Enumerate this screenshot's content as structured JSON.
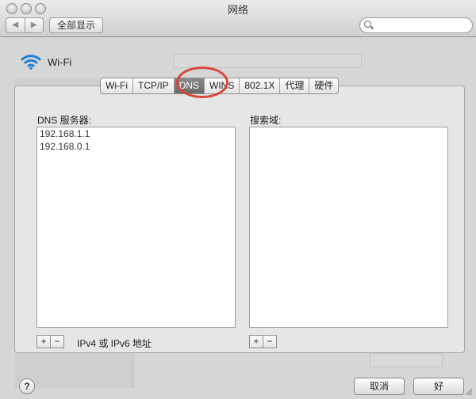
{
  "window": {
    "title": "网络",
    "show_all_label": "全部显示",
    "back_glyph": "◀",
    "forward_glyph": "▶",
    "search_placeholder": ""
  },
  "service": {
    "name": "Wi-Fi"
  },
  "tabs": [
    {
      "label": "Wi-Fi",
      "selected": false
    },
    {
      "label": "TCP/IP",
      "selected": false
    },
    {
      "label": "DNS",
      "selected": true
    },
    {
      "label": "WINS",
      "selected": false
    },
    {
      "label": "802.1X",
      "selected": false
    },
    {
      "label": "代理",
      "selected": false
    },
    {
      "label": "硬件",
      "selected": false
    }
  ],
  "dns_servers": {
    "label": "DNS 服务器:",
    "entries": [
      "192.168.1.1",
      "192.168.0.1"
    ],
    "hint": "IPv4 或 IPv6 地址"
  },
  "search_domains": {
    "label": "搜索域:",
    "entries": []
  },
  "controls": {
    "add": "+",
    "remove": "−",
    "help": "?",
    "cancel": "取消",
    "ok": "好"
  },
  "colors": {
    "highlight_ring": "#d9463a",
    "selected_tab": "#777777"
  }
}
